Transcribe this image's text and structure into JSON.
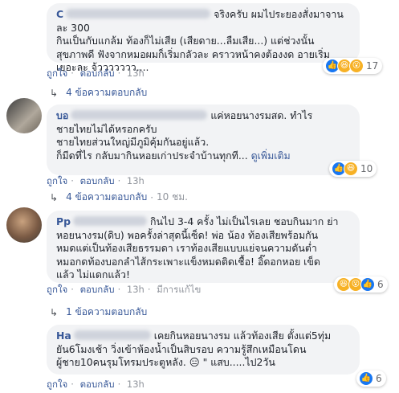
{
  "comments": [
    {
      "name": "C",
      "text": "จริงครับ ผมไประยองสั่งมาจานละ 300\nกินเป็นกับแกล้ม ท้องก็ไม่เสีย (เสียดาย...ลืมเสีย...) แต่ช่วงนั้น\nสุขภาพดี ฟังจากหมอผมก็เริ่มกลัวละ คราวหน้าคงต้องงด อายเริ่ม\nเยอะละ จ้ววววววว....",
      "see_more": "",
      "reactions": {
        "count": "17",
        "icons": [
          "like-icon",
          "haha-icon",
          "wow-icon"
        ]
      },
      "actions": {
        "like": "ถูกใจ",
        "reply": "ตอบกลับ",
        "time": "13h",
        "extra": ""
      },
      "replies": {
        "label": "4 ข้อความตอบกลับ",
        "time": ""
      }
    },
    {
      "name": "บอ",
      "text": "แค่หอยนางรมสด. ทำไร\nชายไทยไม่ได้หรอกครับ\nชายไทยส่วนใหญ่มีภูมิคุ้มกันอยู่แล้ว.\nก็มีดที่ไร กลับมากินหอยเก่าประจำบ้านทุกที...",
      "see_more": "ดูเพิ่มเติม",
      "reactions": {
        "count": "10",
        "icons": [
          "like-icon",
          "haha-icon"
        ]
      },
      "actions": {
        "like": "ถูกใจ",
        "reply": "ตอบกลับ",
        "time": "13h",
        "extra": ""
      },
      "replies": {
        "label": "4 ข้อความตอบกลับ",
        "time": "10 ชม."
      }
    },
    {
      "name": "Pp",
      "text": "กินไป 3-4 ครั้ง ไม่เป็นไรเลย ชอบกินมาก ย่า\nหอยนางรม(ดิบ) พอครั้งล่าสุดนี้เซ็ด! พ่อ น้อง ท้องเสียพร้อมกัน\nหมดแต่เป็นท้องเสียธรรมดา เราท้องเสียแบบแย่จนความดันต่ำ\nหมอกดท้องบอกลำไส้กระเพาะแข็งหมดติดเชื้อ! อิ๊ดอกหอย เข็ด\nแล้ว ไม่แดกแล้ว!",
      "see_more": "",
      "reactions": {
        "count": "6",
        "icons": [
          "haha-icon",
          "wow-icon",
          "like-icon"
        ]
      },
      "actions": {
        "like": "ถูกใจ",
        "reply": "ตอบกลับ",
        "time": "13h",
        "extra": "มีการแก้ไข"
      },
      "replies": {
        "label": "1 ข้อความตอบกลับ",
        "time": ""
      }
    },
    {
      "name": "Ha",
      "text": "เคยกินหอยนางรม แล้วท้องเสีย ตั้งแต่5ทุ่ม\nยัน6โมงเช้า วิ่งเข้าห้องน้ำเป็นสิบรอบ ความรู้สึกเหมือนโดน\nผู้ชาย10คนรุมโทรมประตูหลัง. 😑 \" แสบ.....ไป2วัน",
      "see_more": "",
      "reactions": {
        "count": "6",
        "icons": [
          "like-icon"
        ]
      },
      "actions": {
        "like": "ถูกใจ",
        "reply": "ตอบกลับ",
        "time": "13h",
        "extra": ""
      },
      "replies": {
        "label": "",
        "time": ""
      }
    }
  ]
}
